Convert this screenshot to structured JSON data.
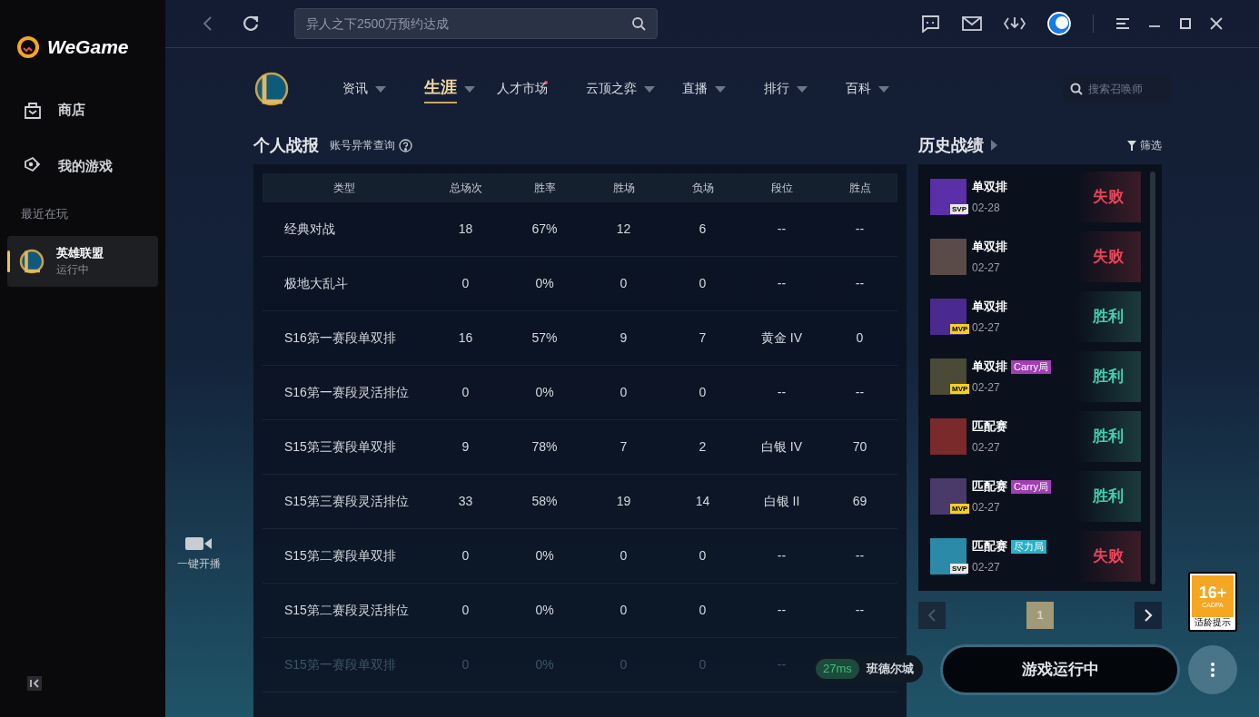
{
  "sidebar": {
    "logo": "WeGame",
    "items": [
      {
        "label": "商店"
      },
      {
        "label": "我的游戏"
      }
    ],
    "recent_label": "最近在玩",
    "recent_games": [
      {
        "name": "英雄联盟",
        "status": "运行中",
        "selected": true
      }
    ],
    "live_label": "一键开播"
  },
  "top_bar": {
    "search": {
      "placeholder": "异人之下2500万预约达成"
    }
  },
  "nav": {
    "items": [
      {
        "label": "资讯",
        "selected": false,
        "dropdown": true,
        "dot": false
      },
      {
        "label": "生涯",
        "selected": true,
        "dropdown": true,
        "dot": false
      },
      {
        "label": "人才市场",
        "selected": false,
        "dropdown": false,
        "dot": true
      },
      {
        "label": "云顶之弈",
        "selected": false,
        "dropdown": true,
        "dot": false
      },
      {
        "label": "直播",
        "selected": false,
        "dropdown": true,
        "dot": false
      },
      {
        "label": "排行",
        "selected": false,
        "dropdown": true,
        "dot": false
      },
      {
        "label": "百科",
        "selected": false,
        "dropdown": true,
        "dot": false
      }
    ],
    "search": {
      "placeholder": "搜索召唤师"
    }
  },
  "stats": {
    "title": "个人战报",
    "link": "账号异常查询",
    "table": {
      "columns": [
        "类型",
        "总场次",
        "胜率",
        "胜场",
        "负场",
        "段位",
        "胜点"
      ],
      "rows": [
        {
          "cells": [
            "经典对战",
            "18",
            "67%",
            "12",
            "6",
            "--",
            "--"
          ],
          "dimmed": false
        },
        {
          "cells": [
            "极地大乱斗",
            "0",
            "0%",
            "0",
            "0",
            "--",
            "--"
          ],
          "dimmed": false
        },
        {
          "cells": [
            "S16第一赛段单双排",
            "16",
            "57%",
            "9",
            "7",
            "黄金 IV",
            "0"
          ],
          "dimmed": false
        },
        {
          "cells": [
            "S16第一赛段灵活排位",
            "0",
            "0%",
            "0",
            "0",
            "--",
            "--"
          ],
          "dimmed": false
        },
        {
          "cells": [
            "S15第三赛段单双排",
            "9",
            "78%",
            "7",
            "2",
            "白银 IV",
            "70"
          ],
          "dimmed": false
        },
        {
          "cells": [
            "S15第三赛段灵活排位",
            "33",
            "58%",
            "19",
            "14",
            "白银 II",
            "69"
          ],
          "dimmed": false
        },
        {
          "cells": [
            "S15第二赛段单双排",
            "0",
            "0%",
            "0",
            "0",
            "--",
            "--"
          ],
          "dimmed": false
        },
        {
          "cells": [
            "S15第二赛段灵活排位",
            "0",
            "0%",
            "0",
            "0",
            "--",
            "--"
          ],
          "dimmed": false
        },
        {
          "cells": [
            "S15第一赛段单双排",
            "0",
            "0%",
            "0",
            "0",
            "--"
          ],
          "dimmed": true
        }
      ]
    }
  },
  "history": {
    "title": "历史战绩",
    "filter": "筛选",
    "matches": [
      {
        "mode": "单双排",
        "date": "02-28",
        "badge": "SVP",
        "result": "失败",
        "won": false,
        "color": "#5b2fa8"
      },
      {
        "mode": "单双排",
        "date": "02-27",
        "result": "失败",
        "won": false,
        "color": "#5a4a48"
      },
      {
        "mode": "单双排",
        "date": "02-27",
        "badge": "MVP",
        "result": "胜利",
        "won": true,
        "color": "#4b2a90"
      },
      {
        "mode": "单双排",
        "date": "02-27",
        "badge": "MVP",
        "tag": {
          "label": "Carry局",
          "color": "#a23fb4"
        },
        "result": "胜利",
        "won": true,
        "color": "#4a4a36"
      },
      {
        "mode": "匹配赛",
        "date": "02-27",
        "result": "胜利",
        "won": true,
        "color": "#7a2a2a"
      },
      {
        "mode": "匹配赛",
        "date": "02-27",
        "badge": "MVP",
        "tag": {
          "label": "Carry局",
          "color": "#a23fb4"
        },
        "result": "胜利",
        "won": true,
        "color": "#4a3a6a"
      },
      {
        "mode": "匹配赛",
        "date": "02-27",
        "badge": "SVP",
        "tag": {
          "label": "尽力局",
          "color": "#2bb0c8"
        },
        "result": "失败",
        "won": false,
        "color": "#2a8aa8"
      }
    ],
    "page": "1"
  },
  "footer": {
    "ping": "27ms",
    "server": "班德尔城",
    "launch": "游戏运行中",
    "age": {
      "rating": "16+",
      "org": "CADPA",
      "label": "适龄提示"
    }
  }
}
